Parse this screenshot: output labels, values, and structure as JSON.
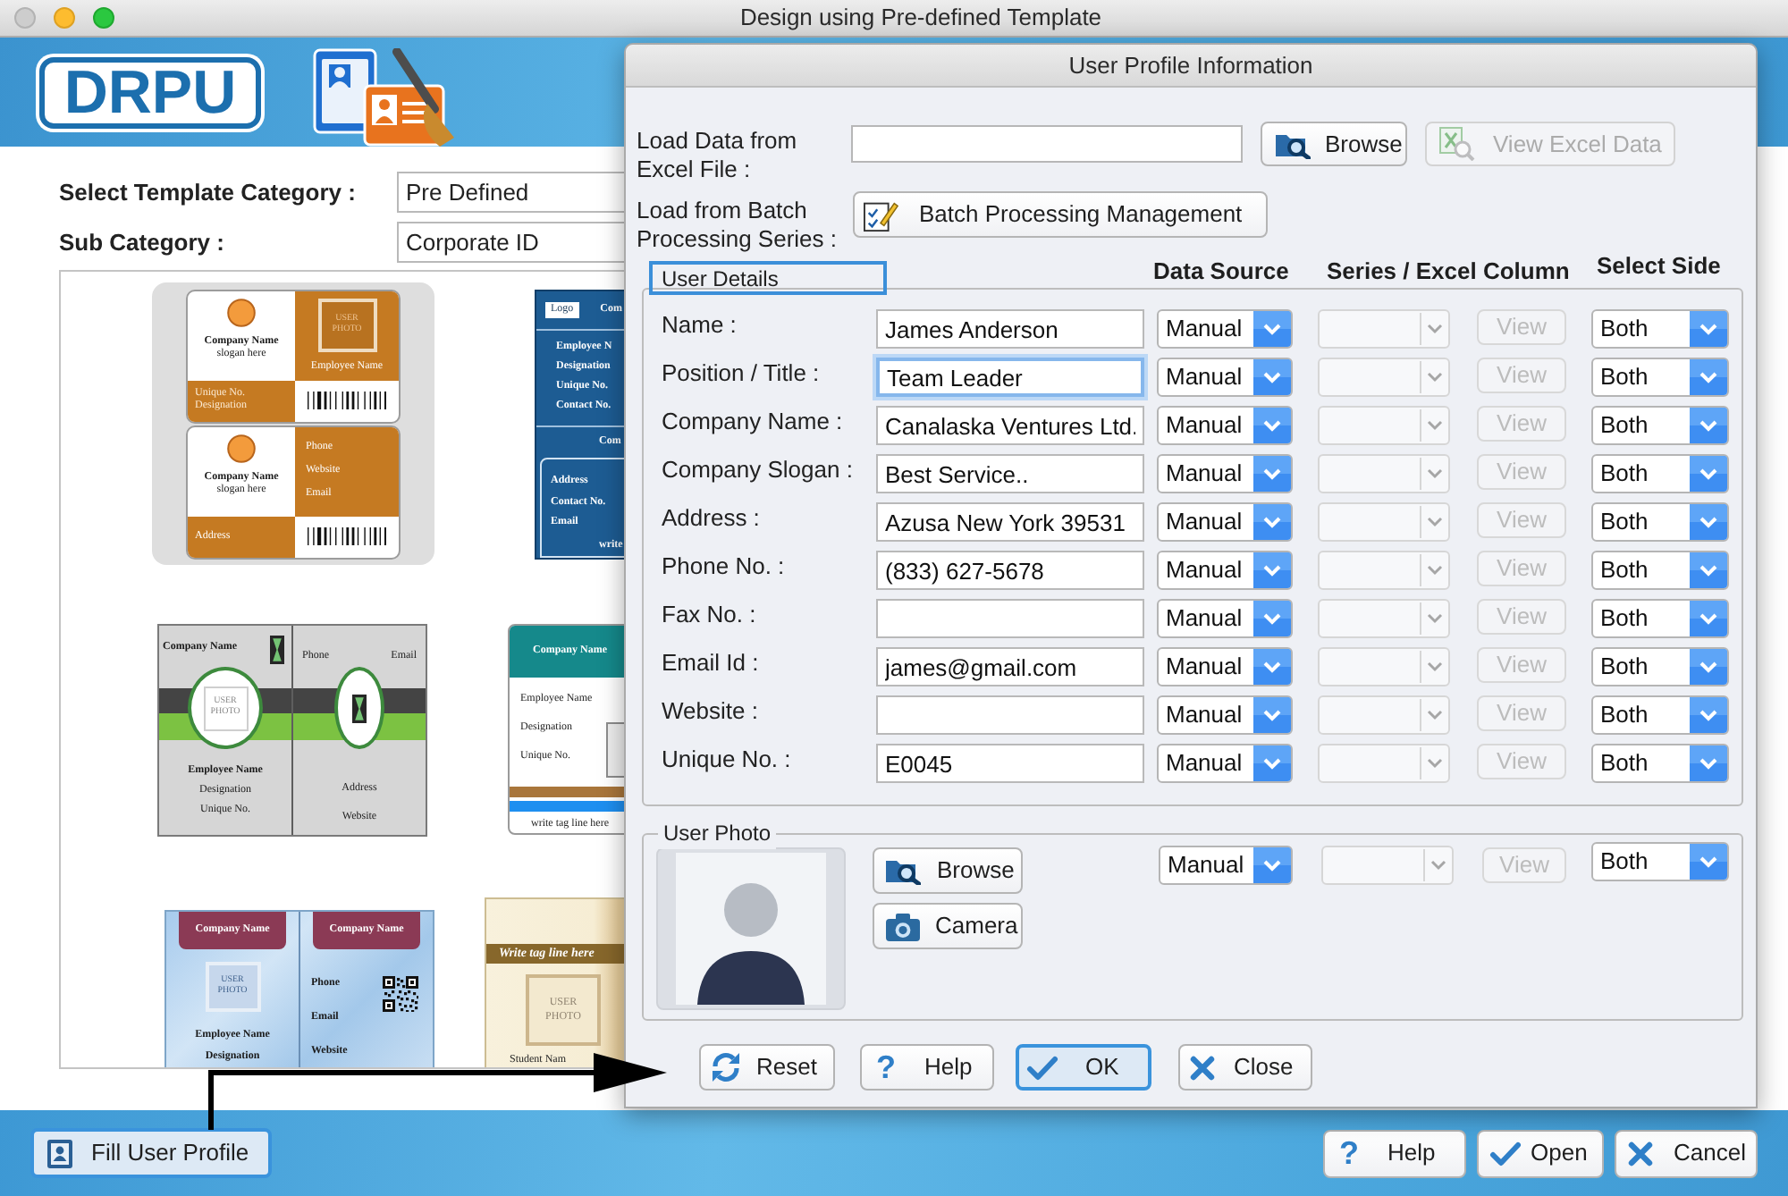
{
  "window": {
    "title": "Design using Pre-defined Template"
  },
  "header": {
    "logo": "DRPU"
  },
  "template_options": [
    {
      "label": "Select Template Category :",
      "value": "Pre Defined"
    },
    {
      "label": "Sub Category :",
      "value": "Corporate ID"
    }
  ],
  "templates": [
    {
      "kind": "orange_badge",
      "selected": true,
      "texts": [
        "Company Name",
        "slogan here",
        "USER PHOTO",
        "Employee Name",
        "Unique No.",
        "Designation",
        "Company Name",
        "slogan here",
        "Phone",
        "Website",
        "Email",
        "Address"
      ]
    },
    {
      "kind": "blue_list",
      "selected": false,
      "texts": [
        "Logo",
        "Com",
        "Employee N",
        "Designation",
        "Unique No.",
        "Contact No.",
        "Com",
        "Address",
        "Contact No.",
        "Email",
        "write"
      ]
    },
    {
      "kind": "grey_split",
      "selected": false,
      "texts": [
        "Company Name",
        "USER PHOTO",
        "Employee Name",
        "Designation",
        "Unique No.",
        "Phone",
        "Email",
        "Address",
        "Website"
      ]
    },
    {
      "kind": "teal_header",
      "selected": false,
      "texts": [
        "Company Name",
        "Employee Name",
        "Designation",
        "Unique No.",
        "write tag line here"
      ]
    },
    {
      "kind": "blue_split",
      "selected": false,
      "texts": [
        "Company Name",
        "USER PHOTO",
        "Employee Name",
        "Designation",
        "Company Name",
        "Phone",
        "Email",
        "Website"
      ]
    },
    {
      "kind": "beige_tagline",
      "selected": false,
      "texts": [
        "Write tag line here",
        "USER PHOTO",
        "Student Nam"
      ]
    }
  ],
  "bottom_bar": {
    "buttons": [
      {
        "kind": "profile",
        "label": "Fill User Profile",
        "highlighted": true
      },
      {
        "kind": "help",
        "icon": "?",
        "label": "Help",
        "highlighted": false
      },
      {
        "kind": "open",
        "label": "Open",
        "highlighted": false
      },
      {
        "kind": "cancel",
        "label": "Cancel",
        "highlighted": false
      }
    ]
  },
  "dialog": {
    "title": "User Profile Information",
    "excel_row": {
      "label": "Load Data from Excel File :",
      "browse": "Browse",
      "view": "View Excel Data",
      "view_disabled": true
    },
    "batch_row": {
      "label": "Load from Batch Processing Series :",
      "button": "Batch Processing Management"
    },
    "columns": [
      "Data Source",
      "Series / Excel Column",
      "Select Side"
    ],
    "user_details": {
      "legend": "User Details",
      "highlighted": true,
      "rows": [
        {
          "label": "Name :",
          "value": "James Anderson",
          "focused": false,
          "source": "Manual",
          "series_disabled": true,
          "view": "View",
          "view_disabled": true,
          "side": "Both"
        },
        {
          "label": "Position / Title :",
          "value": "Team Leader",
          "focused": true,
          "source": "Manual",
          "series_disabled": true,
          "view": "View",
          "view_disabled": true,
          "side": "Both"
        },
        {
          "label": "Company Name :",
          "value": "Canalaska Ventures Ltd.",
          "focused": false,
          "source": "Manual",
          "series_disabled": true,
          "view": "View",
          "view_disabled": true,
          "side": "Both"
        },
        {
          "label": "Company Slogan :",
          "value": "Best Service..",
          "focused": false,
          "source": "Manual",
          "series_disabled": true,
          "view": "View",
          "view_disabled": true,
          "side": "Both"
        },
        {
          "label": "Address :",
          "value": "Azusa New York 39531",
          "focused": false,
          "source": "Manual",
          "series_disabled": true,
          "view": "View",
          "view_disabled": true,
          "side": "Both"
        },
        {
          "label": "Phone No. :",
          "value": "(833) 627-5678",
          "focused": false,
          "source": "Manual",
          "series_disabled": true,
          "view": "View",
          "view_disabled": true,
          "side": "Both"
        },
        {
          "label": "Fax No. :",
          "focused": false,
          "source": "Manual",
          "series_disabled": true,
          "view": "View",
          "view_disabled": true,
          "side": "Both"
        },
        {
          "label": "Email Id :",
          "value": "james@gmail.com",
          "focused": false,
          "source": "Manual",
          "series_disabled": true,
          "view": "View",
          "view_disabled": true,
          "side": "Both"
        },
        {
          "label": "Website :",
          "focused": false,
          "source": "Manual",
          "series_disabled": true,
          "view": "View",
          "view_disabled": true,
          "side": "Both"
        },
        {
          "label": "Unique No. :",
          "value": "E0045",
          "focused": false,
          "source": "Manual",
          "series_disabled": true,
          "view": "View",
          "view_disabled": true,
          "side": "Both"
        }
      ]
    },
    "user_photo": {
      "legend": "User Photo",
      "browse": "Browse",
      "camera": "Camera",
      "source": "Manual",
      "series_disabled": true,
      "view": "View",
      "view_disabled": true,
      "side": "Both"
    },
    "buttons": [
      {
        "kind": "reset",
        "label": "Reset",
        "highlighted": false
      },
      {
        "kind": "help",
        "icon": "?",
        "label": "Help",
        "highlighted": false
      },
      {
        "kind": "ok",
        "label": "OK",
        "highlighted": true
      },
      {
        "kind": "close",
        "label": "Close",
        "highlighted": false
      }
    ]
  }
}
